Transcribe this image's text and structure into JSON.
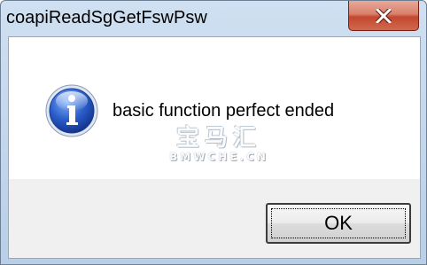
{
  "window": {
    "title": "coapiReadSgGetFswPsw"
  },
  "dialog": {
    "icon": "information-icon",
    "message": "basic function perfect ended",
    "ok_label": "OK"
  },
  "watermark": {
    "logo": "宝马汇",
    "text": "BMWCHE.CN"
  },
  "colors": {
    "title_bar": "#c5d8ee",
    "close_button": "#c4472f",
    "info_icon": "#2a5cc8",
    "button_area": "#f0f0f0"
  }
}
